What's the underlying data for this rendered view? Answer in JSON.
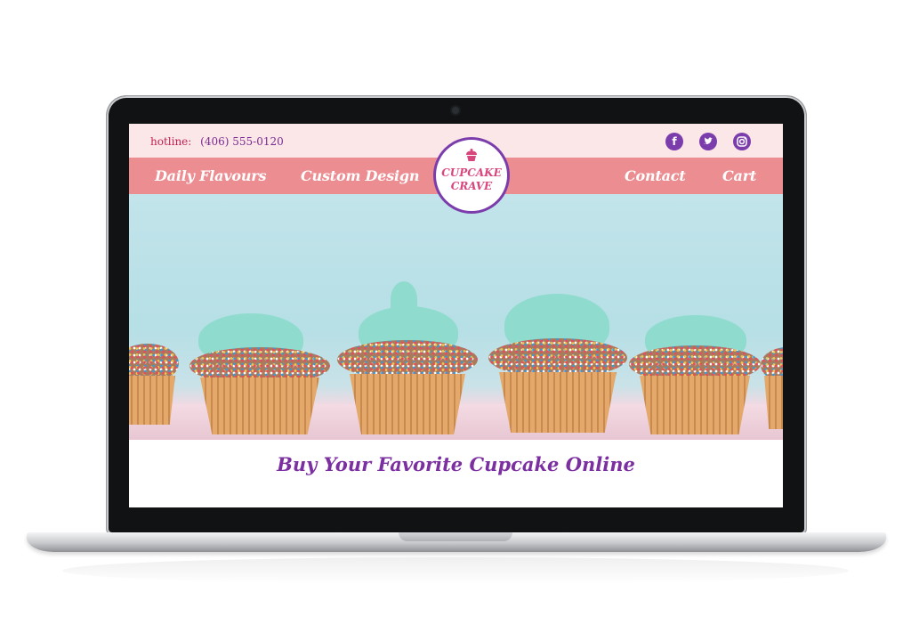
{
  "topbar": {
    "hotline_label": "hotline:",
    "hotline_phone": "(406) 555-0120",
    "social_icons": [
      "facebook-icon",
      "twitter-icon",
      "instagram-icon"
    ]
  },
  "nav": {
    "left": [
      "Daily Flavours",
      "Custom Design"
    ],
    "right": [
      "Contact",
      "Cart"
    ]
  },
  "logo": {
    "line1": "CUPCAKE",
    "line2": "CRAVE"
  },
  "hero": {
    "tagline": "Buy Your Favorite Cupcake Online"
  },
  "colors": {
    "topbar_bg": "#fbe7e8",
    "nav_bg": "#ec8d91",
    "accent_purple": "#7b3dab",
    "logo_pink": "#d8467e",
    "hotline_red": "#c2204e"
  }
}
